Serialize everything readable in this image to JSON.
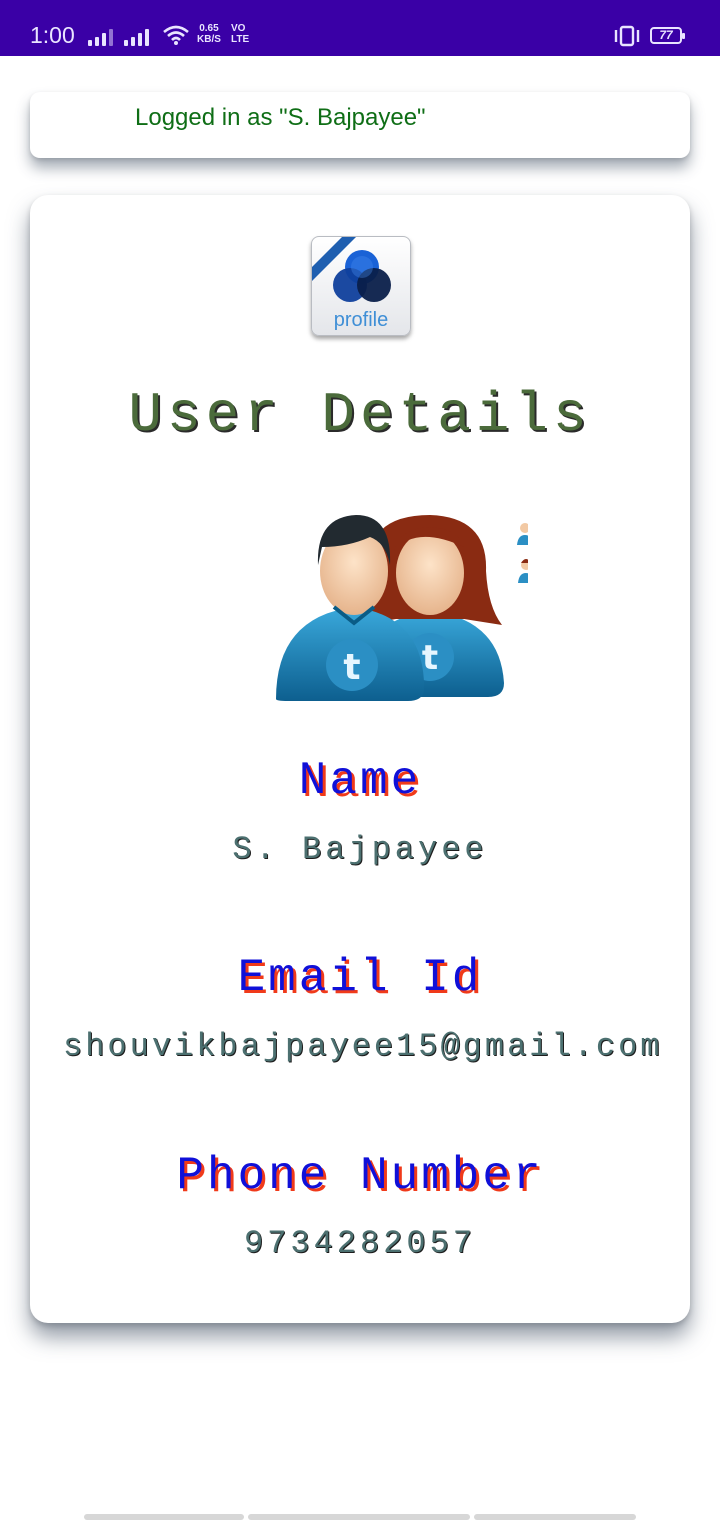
{
  "status_bar": {
    "time": "1:00",
    "net_speed_value": "0.65",
    "net_speed_unit": "KB/S",
    "volte_top": "VO",
    "volte_bottom": "LTE",
    "battery": "77",
    "background": "#3a00a6"
  },
  "login": {
    "text": "Logged in as \"S. Bajpayee\""
  },
  "profile_icon": {
    "label": "profile"
  },
  "details": {
    "title": "User Details",
    "name_label": "Name",
    "name_value": "S. Bajpayee",
    "email_label": "Email Id",
    "email_value": "shouvikbajpayee15@gmail.com",
    "phone_label": "Phone Number",
    "phone_value": "9734282057"
  },
  "colors": {
    "login_text": "#0f6e16",
    "title": "#4b6b3b",
    "label": "#1010d8",
    "label_shadow": "#f03a1a",
    "value": "#4c7070"
  }
}
